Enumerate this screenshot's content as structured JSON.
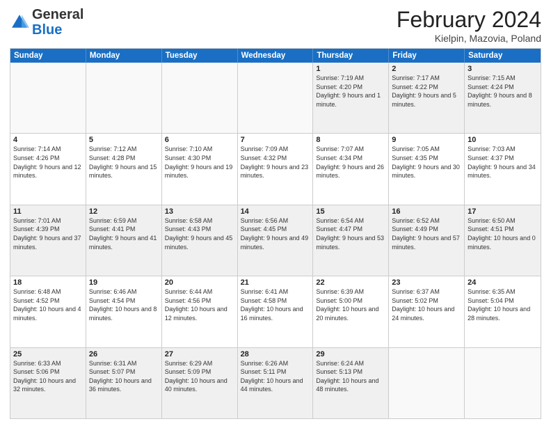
{
  "header": {
    "logo_general": "General",
    "logo_blue": "Blue",
    "main_title": "February 2024",
    "subtitle": "Kielpin, Mazovia, Poland"
  },
  "calendar": {
    "days_of_week": [
      "Sunday",
      "Monday",
      "Tuesday",
      "Wednesday",
      "Thursday",
      "Friday",
      "Saturday"
    ],
    "weeks": [
      [
        {
          "day": "",
          "info": "",
          "empty": true
        },
        {
          "day": "",
          "info": "",
          "empty": true
        },
        {
          "day": "",
          "info": "",
          "empty": true
        },
        {
          "day": "",
          "info": "",
          "empty": true
        },
        {
          "day": "1",
          "info": "Sunrise: 7:19 AM\nSunset: 4:20 PM\nDaylight: 9 hours and 1 minute."
        },
        {
          "day": "2",
          "info": "Sunrise: 7:17 AM\nSunset: 4:22 PM\nDaylight: 9 hours and 5 minutes."
        },
        {
          "day": "3",
          "info": "Sunrise: 7:15 AM\nSunset: 4:24 PM\nDaylight: 9 hours and 8 minutes."
        }
      ],
      [
        {
          "day": "4",
          "info": "Sunrise: 7:14 AM\nSunset: 4:26 PM\nDaylight: 9 hours and 12 minutes."
        },
        {
          "day": "5",
          "info": "Sunrise: 7:12 AM\nSunset: 4:28 PM\nDaylight: 9 hours and 15 minutes."
        },
        {
          "day": "6",
          "info": "Sunrise: 7:10 AM\nSunset: 4:30 PM\nDaylight: 9 hours and 19 minutes."
        },
        {
          "day": "7",
          "info": "Sunrise: 7:09 AM\nSunset: 4:32 PM\nDaylight: 9 hours and 23 minutes."
        },
        {
          "day": "8",
          "info": "Sunrise: 7:07 AM\nSunset: 4:34 PM\nDaylight: 9 hours and 26 minutes."
        },
        {
          "day": "9",
          "info": "Sunrise: 7:05 AM\nSunset: 4:35 PM\nDaylight: 9 hours and 30 minutes."
        },
        {
          "day": "10",
          "info": "Sunrise: 7:03 AM\nSunset: 4:37 PM\nDaylight: 9 hours and 34 minutes."
        }
      ],
      [
        {
          "day": "11",
          "info": "Sunrise: 7:01 AM\nSunset: 4:39 PM\nDaylight: 9 hours and 37 minutes."
        },
        {
          "day": "12",
          "info": "Sunrise: 6:59 AM\nSunset: 4:41 PM\nDaylight: 9 hours and 41 minutes."
        },
        {
          "day": "13",
          "info": "Sunrise: 6:58 AM\nSunset: 4:43 PM\nDaylight: 9 hours and 45 minutes."
        },
        {
          "day": "14",
          "info": "Sunrise: 6:56 AM\nSunset: 4:45 PM\nDaylight: 9 hours and 49 minutes."
        },
        {
          "day": "15",
          "info": "Sunrise: 6:54 AM\nSunset: 4:47 PM\nDaylight: 9 hours and 53 minutes."
        },
        {
          "day": "16",
          "info": "Sunrise: 6:52 AM\nSunset: 4:49 PM\nDaylight: 9 hours and 57 minutes."
        },
        {
          "day": "17",
          "info": "Sunrise: 6:50 AM\nSunset: 4:51 PM\nDaylight: 10 hours and 0 minutes."
        }
      ],
      [
        {
          "day": "18",
          "info": "Sunrise: 6:48 AM\nSunset: 4:52 PM\nDaylight: 10 hours and 4 minutes."
        },
        {
          "day": "19",
          "info": "Sunrise: 6:46 AM\nSunset: 4:54 PM\nDaylight: 10 hours and 8 minutes."
        },
        {
          "day": "20",
          "info": "Sunrise: 6:44 AM\nSunset: 4:56 PM\nDaylight: 10 hours and 12 minutes."
        },
        {
          "day": "21",
          "info": "Sunrise: 6:41 AM\nSunset: 4:58 PM\nDaylight: 10 hours and 16 minutes."
        },
        {
          "day": "22",
          "info": "Sunrise: 6:39 AM\nSunset: 5:00 PM\nDaylight: 10 hours and 20 minutes."
        },
        {
          "day": "23",
          "info": "Sunrise: 6:37 AM\nSunset: 5:02 PM\nDaylight: 10 hours and 24 minutes."
        },
        {
          "day": "24",
          "info": "Sunrise: 6:35 AM\nSunset: 5:04 PM\nDaylight: 10 hours and 28 minutes."
        }
      ],
      [
        {
          "day": "25",
          "info": "Sunrise: 6:33 AM\nSunset: 5:06 PM\nDaylight: 10 hours and 32 minutes."
        },
        {
          "day": "26",
          "info": "Sunrise: 6:31 AM\nSunset: 5:07 PM\nDaylight: 10 hours and 36 minutes."
        },
        {
          "day": "27",
          "info": "Sunrise: 6:29 AM\nSunset: 5:09 PM\nDaylight: 10 hours and 40 minutes."
        },
        {
          "day": "28",
          "info": "Sunrise: 6:26 AM\nSunset: 5:11 PM\nDaylight: 10 hours and 44 minutes."
        },
        {
          "day": "29",
          "info": "Sunrise: 6:24 AM\nSunset: 5:13 PM\nDaylight: 10 hours and 48 minutes."
        },
        {
          "day": "",
          "info": "",
          "empty": true
        },
        {
          "day": "",
          "info": "",
          "empty": true
        }
      ]
    ]
  }
}
